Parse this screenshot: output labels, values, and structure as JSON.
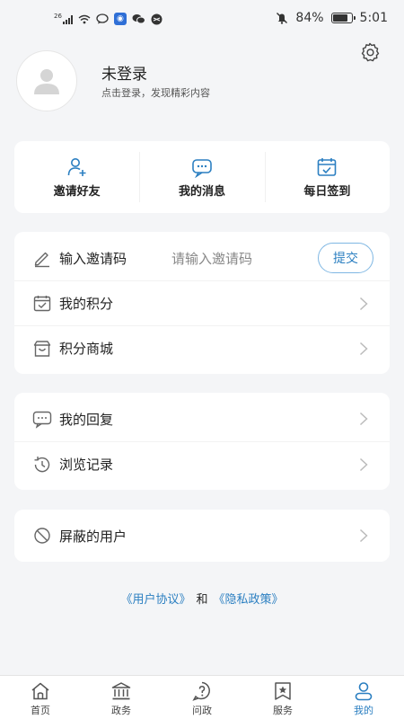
{
  "status_bar": {
    "network_label": "26",
    "battery_percent": "84%",
    "battery_level": 0.84,
    "time": "5:01",
    "icons": [
      "signal-icon",
      "wifi-icon",
      "chat-bubble-icon",
      "app-badge-icon",
      "wechat-icon",
      "app-icon",
      "mute-icon",
      "battery-icon"
    ]
  },
  "profile": {
    "title": "未登录",
    "subtitle": "点击登录，发现精彩内容",
    "avatar_icon": "user-avatar-icon",
    "settings_icon": "gear-icon"
  },
  "quick_actions": [
    {
      "label": "邀请好友",
      "icon": "add-user-icon"
    },
    {
      "label": "我的消息",
      "icon": "message-icon"
    },
    {
      "label": "每日签到",
      "icon": "calendar-check-icon"
    }
  ],
  "invite": {
    "label": "输入邀请码",
    "placeholder": "请输入邀请码",
    "submit_label": "提交"
  },
  "menu_group_1": [
    {
      "label": "我的积分",
      "icon": "points-icon"
    },
    {
      "label": "积分商城",
      "icon": "shop-icon"
    }
  ],
  "menu_group_2": [
    {
      "label": "我的回复",
      "icon": "reply-icon"
    },
    {
      "label": "浏览记录",
      "icon": "history-icon"
    }
  ],
  "menu_group_3": [
    {
      "label": "屏蔽的用户",
      "icon": "block-icon"
    }
  ],
  "footer_links": {
    "user_agreement": "《用户协议》",
    "and": "和",
    "privacy_policy": "《隐私政策》"
  },
  "tabs": [
    {
      "label": "首页",
      "icon": "home-icon",
      "active": false
    },
    {
      "label": "政务",
      "icon": "government-icon",
      "active": false
    },
    {
      "label": "问政",
      "icon": "question-icon",
      "active": false
    },
    {
      "label": "服务",
      "icon": "service-icon",
      "active": false
    },
    {
      "label": "我的",
      "icon": "profile-icon",
      "active": true
    }
  ],
  "colors": {
    "accent": "#2b7fc1",
    "background": "#f4f5f7",
    "card": "#ffffff"
  }
}
